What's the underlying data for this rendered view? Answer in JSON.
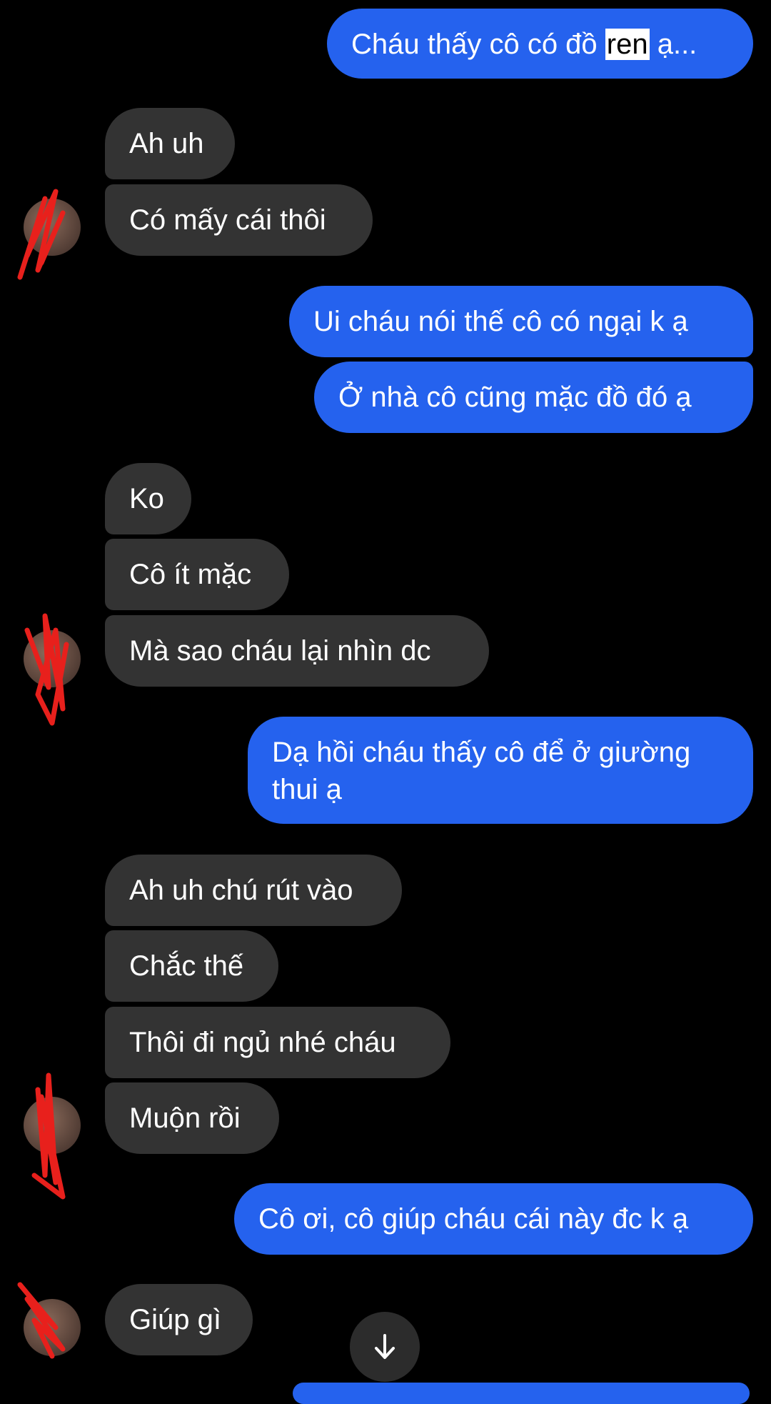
{
  "messages": [
    {
      "side": "out",
      "text_pre": "Cháu thấy cô có đồ ",
      "text_highlight": "ren",
      "text_post": " ạ..."
    },
    {
      "side": "in",
      "text": "Ah uh"
    },
    {
      "side": "in",
      "text": "Có mấy cái thôi"
    },
    {
      "side": "out",
      "text": "Ui cháu nói thế cô có ngại k ạ"
    },
    {
      "side": "out",
      "text": "Ở nhà cô cũng mặc đồ đó ạ"
    },
    {
      "side": "in",
      "text": "Ko"
    },
    {
      "side": "in",
      "text": "Cô ít mặc"
    },
    {
      "side": "in",
      "text": "Mà sao cháu lại nhìn dc"
    },
    {
      "side": "out",
      "text": "Dạ hồi cháu thấy cô để ở giường thui ạ"
    },
    {
      "side": "in",
      "text": "Ah uh chú rút vào"
    },
    {
      "side": "in",
      "text": "Chắc thế"
    },
    {
      "side": "in",
      "text": "Thôi đi ngủ nhé cháu"
    },
    {
      "side": "in",
      "text": "Muộn rồi"
    },
    {
      "side": "out",
      "text": "Cô ơi, cô giúp cháu cái này đc k ạ"
    },
    {
      "side": "in",
      "text": "Giúp gì"
    }
  ],
  "icons": {
    "scroll_down": "arrow-down-icon",
    "avatar": "contact-avatar"
  },
  "colors": {
    "background": "#000000",
    "outgoing_bubble": "#2562ee",
    "incoming_bubble": "#333333",
    "text": "#ffffff",
    "redaction_scribble": "#e8201c"
  }
}
